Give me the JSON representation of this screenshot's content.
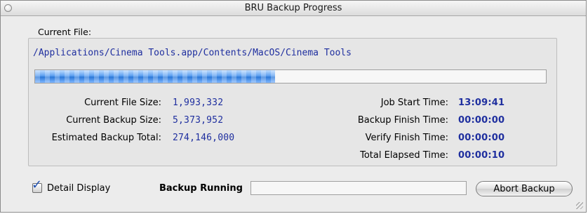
{
  "window": {
    "title": "BRU Backup Progress"
  },
  "current_file": {
    "label": "Current File:",
    "path": "/Applications/Cinema Tools.app/Contents/MacOS/Cinema Tools",
    "progress_fraction": 0.47
  },
  "stats_left": [
    {
      "label": "Current File Size:",
      "value": "1,993,332"
    },
    {
      "label": "Current Backup Size:",
      "value": "5,373,952"
    },
    {
      "label": "Estimated Backup Total:",
      "value": "274,146,000"
    }
  ],
  "stats_right": [
    {
      "label": "Job Start Time:",
      "value": "13:09:41"
    },
    {
      "label": "Backup Finish Time:",
      "value": "00:00:00"
    },
    {
      "label": "Verify Finish Time:",
      "value": "00:00:00"
    },
    {
      "label": "Total Elapsed Time:",
      "value": "00:00:10"
    }
  ],
  "footer": {
    "detail_label": "Detail Display",
    "detail_checked": true,
    "status_text": "Backup Running",
    "overall_progress_fraction": 0.0,
    "abort_label": "Abort Backup"
  },
  "colors": {
    "value_text": "#1f2f9f",
    "progress_fill": "#2b78d8",
    "window_bg": "#ececec"
  }
}
